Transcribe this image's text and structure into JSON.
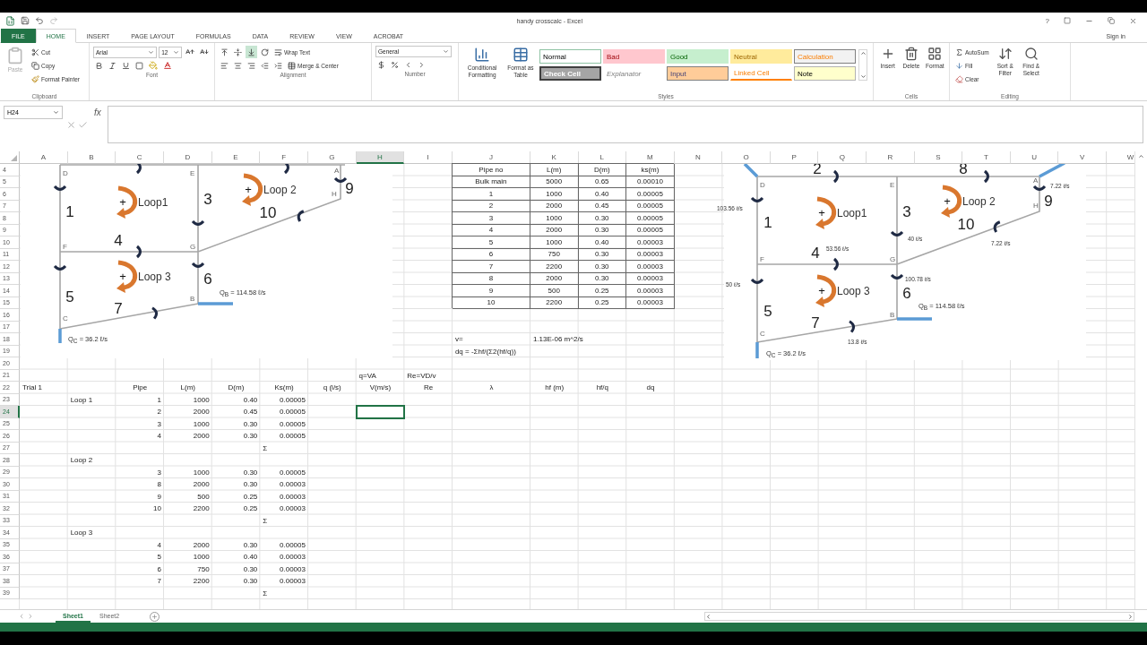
{
  "title_bar": {
    "title": "handy crosscalc - Excel",
    "help": "?"
  },
  "tabs": [
    {
      "label": "FILE",
      "kind": "file",
      "selected": false
    },
    {
      "label": "HOME",
      "kind": "tab",
      "selected": true
    },
    {
      "label": "INSERT",
      "kind": "tab",
      "selected": false
    },
    {
      "label": "PAGE LAYOUT",
      "kind": "tab",
      "selected": false
    },
    {
      "label": "FORMULAS",
      "kind": "tab",
      "selected": false
    },
    {
      "label": "DATA",
      "kind": "tab",
      "selected": false
    },
    {
      "label": "REVIEW",
      "kind": "tab",
      "selected": false
    },
    {
      "label": "VIEW",
      "kind": "tab",
      "selected": false
    },
    {
      "label": "ACROBAT",
      "kind": "tab",
      "selected": false
    }
  ],
  "account": "Sign in",
  "ribbon": {
    "clipboard": {
      "label": "Clipboard",
      "paste": {
        "label": "Paste",
        "disabled": true
      },
      "cut": "Cut",
      "copy": "Copy",
      "format_painter": "Format Painter"
    },
    "font": {
      "label": "Font",
      "name": "Arial",
      "size": "12"
    },
    "alignment": {
      "label": "Alignment",
      "wrap": "Wrap Text",
      "merge": "Merge & Center",
      "vertical_align": [
        {
          "selected": false
        },
        {
          "selected": false
        },
        {
          "selected": true
        }
      ]
    },
    "number": {
      "label": "Number",
      "format": "General"
    },
    "styles": {
      "label": "Styles",
      "conditional": "Conditional Formatting",
      "format_table": "Format as Table",
      "gallery": [
        {
          "text": "Normal",
          "kind": "normal"
        },
        {
          "text": "Bad",
          "kind": "bad"
        },
        {
          "text": "Good",
          "kind": "good"
        },
        {
          "text": "Neutral",
          "kind": "neutral"
        },
        {
          "text": "Calculation",
          "kind": "calculation"
        },
        {
          "text": "Check Cell",
          "kind": "check"
        },
        {
          "text": "Explanator",
          "kind": "explanatory"
        },
        {
          "text": "Input",
          "kind": "input"
        },
        {
          "text": "Linked Cell",
          "kind": "linked"
        },
        {
          "text": "Note",
          "kind": "note"
        }
      ]
    },
    "cells": {
      "label": "Cells",
      "buttons": [
        "Insert",
        "Delete",
        "Format"
      ]
    },
    "editing": {
      "label": "Editing",
      "autosum": "AutoSum",
      "fill": "Fill",
      "clear": "Clear",
      "sort": "Sort & Filter",
      "find": "Find & Select"
    }
  },
  "formula_bar": {
    "name_box": "H24",
    "insert_function": "fx"
  },
  "sheet": {
    "columns": [
      {
        "label": "A",
        "selected": false
      },
      {
        "label": "B",
        "selected": false
      },
      {
        "label": "C",
        "selected": false
      },
      {
        "label": "D",
        "selected": false
      },
      {
        "label": "E",
        "selected": false
      },
      {
        "label": "F",
        "selected": false
      },
      {
        "label": "G",
        "selected": false
      },
      {
        "label": "H",
        "selected": true
      },
      {
        "label": "I",
        "selected": false
      },
      {
        "label": "J",
        "selected": false
      },
      {
        "label": "K",
        "selected": false
      },
      {
        "label": "L",
        "selected": false
      },
      {
        "label": "M",
        "selected": false
      },
      {
        "label": "N",
        "selected": false
      },
      {
        "label": "O",
        "selected": false
      },
      {
        "label": "P",
        "selected": false
      },
      {
        "label": "Q",
        "selected": false
      },
      {
        "label": "R",
        "selected": false
      },
      {
        "label": "S",
        "selected": false
      },
      {
        "label": "T",
        "selected": false
      },
      {
        "label": "U",
        "selected": false
      },
      {
        "label": "V",
        "selected": false
      },
      {
        "label": "W",
        "selected": false
      }
    ],
    "rows": [
      {
        "number": "4",
        "selected": false,
        "cells": {
          "J": {
            "text": "Pipe no",
            "kind": "table",
            "selected": false
          },
          "K": {
            "text": "L(m)",
            "kind": "table",
            "selected": false
          },
          "L": {
            "text": "D(m)",
            "kind": "table",
            "selected": false
          },
          "M": {
            "text": "ks(m)",
            "kind": "table",
            "selected": false
          }
        }
      },
      {
        "number": "5",
        "selected": false,
        "cells": {
          "J": {
            "text": "Bulk main",
            "kind": "table",
            "selected": false
          },
          "K": {
            "text": "5000",
            "kind": "table",
            "selected": false
          },
          "L": {
            "text": "0.65",
            "kind": "table",
            "selected": false
          },
          "M": {
            "text": "0.00010",
            "kind": "table",
            "selected": false
          }
        }
      },
      {
        "number": "6",
        "selected": false,
        "cells": {
          "J": {
            "text": "1",
            "kind": "table",
            "selected": false
          },
          "K": {
            "text": "1000",
            "kind": "table",
            "selected": false
          },
          "L": {
            "text": "0.40",
            "kind": "table",
            "selected": false
          },
          "M": {
            "text": "0.00005",
            "kind": "table",
            "selected": false
          }
        }
      },
      {
        "number": "7",
        "selected": false,
        "cells": {
          "J": {
            "text": "2",
            "kind": "table",
            "selected": false
          },
          "K": {
            "text": "2000",
            "kind": "table",
            "selected": false
          },
          "L": {
            "text": "0.45",
            "kind": "table",
            "selected": false
          },
          "M": {
            "text": "0.00005",
            "kind": "table",
            "selected": false
          }
        }
      },
      {
        "number": "8",
        "selected": false,
        "cells": {
          "J": {
            "text": "3",
            "kind": "table",
            "selected": false
          },
          "K": {
            "text": "1000",
            "kind": "table",
            "selected": false
          },
          "L": {
            "text": "0.30",
            "kind": "table",
            "selected": false
          },
          "M": {
            "text": "0.00005",
            "kind": "table",
            "selected": false
          }
        }
      },
      {
        "number": "9",
        "selected": false,
        "cells": {
          "J": {
            "text": "4",
            "kind": "table",
            "selected": false
          },
          "K": {
            "text": "2000",
            "kind": "table",
            "selected": false
          },
          "L": {
            "text": "0.30",
            "kind": "table",
            "selected": false
          },
          "M": {
            "text": "0.00005",
            "kind": "table",
            "selected": false
          }
        }
      },
      {
        "number": "10",
        "selected": false,
        "cells": {
          "J": {
            "text": "5",
            "kind": "table",
            "selected": false
          },
          "K": {
            "text": "1000",
            "kind": "table",
            "selected": false
          },
          "L": {
            "text": "0.40",
            "kind": "table",
            "selected": false
          },
          "M": {
            "text": "0.00003",
            "kind": "table",
            "selected": false
          }
        }
      },
      {
        "number": "11",
        "selected": false,
        "cells": {
          "J": {
            "text": "6",
            "kind": "table",
            "selected": false
          },
          "K": {
            "text": "750",
            "kind": "table",
            "selected": false
          },
          "L": {
            "text": "0.30",
            "kind": "table",
            "selected": false
          },
          "M": {
            "text": "0.00003",
            "kind": "table",
            "selected": false
          }
        }
      },
      {
        "number": "12",
        "selected": false,
        "cells": {
          "J": {
            "text": "7",
            "kind": "table",
            "selected": false
          },
          "K": {
            "text": "2200",
            "kind": "table",
            "selected": false
          },
          "L": {
            "text": "0.30",
            "kind": "table",
            "selected": false
          },
          "M": {
            "text": "0.00003",
            "kind": "table",
            "selected": false
          }
        }
      },
      {
        "number": "13",
        "selected": false,
        "cells": {
          "J": {
            "text": "8",
            "kind": "table",
            "selected": false
          },
          "K": {
            "text": "2000",
            "kind": "table",
            "selected": false
          },
          "L": {
            "text": "0.30",
            "kind": "table",
            "selected": false
          },
          "M": {
            "text": "0.00003",
            "kind": "table",
            "selected": false
          }
        }
      },
      {
        "number": "14",
        "selected": false,
        "cells": {
          "J": {
            "text": "9",
            "kind": "table",
            "selected": false
          },
          "K": {
            "text": "500",
            "kind": "table",
            "selected": false
          },
          "L": {
            "text": "0.25",
            "kind": "table",
            "selected": false
          },
          "M": {
            "text": "0.00003",
            "kind": "table",
            "selected": false
          }
        }
      },
      {
        "number": "15",
        "selected": false,
        "cells": {
          "J": {
            "text": "10",
            "kind": "table",
            "selected": false
          },
          "K": {
            "text": "2200",
            "kind": "table",
            "selected": false
          },
          "L": {
            "text": "0.25",
            "kind": "table",
            "selected": false
          },
          "M": {
            "text": "0.00003",
            "kind": "table",
            "selected": false
          }
        }
      },
      {
        "number": "16",
        "selected": false
      },
      {
        "number": "17",
        "selected": false
      },
      {
        "number": "18",
        "selected": false,
        "cells": {
          "J": {
            "text": "v=",
            "kind": "text",
            "selected": false
          },
          "K": {
            "text": "1.13E-06 m^2/s",
            "kind": "spill",
            "selected": false
          }
        }
      },
      {
        "number": "19",
        "selected": false,
        "cells": {
          "J": {
            "text": "dq = -Σhf/(Σ2(hf/q))",
            "kind": "spill",
            "selected": false
          }
        }
      },
      {
        "number": "20",
        "selected": false
      },
      {
        "number": "21",
        "selected": false,
        "cells": {
          "H": {
            "text": "q=VA",
            "kind": "text",
            "selected": false
          },
          "I": {
            "text": "Re=VD/v",
            "kind": "text",
            "selected": false
          }
        }
      },
      {
        "number": "22",
        "selected": false,
        "cells": {
          "A": {
            "text": "Trial 1",
            "kind": "text",
            "selected": false
          },
          "C": {
            "text": "Pipe",
            "kind": "heading",
            "selected": false
          },
          "D": {
            "text": "L(m)",
            "kind": "heading",
            "selected": false
          },
          "E": {
            "text": "D(m)",
            "kind": "heading",
            "selected": false
          },
          "F": {
            "text": "Ks(m)",
            "kind": "heading",
            "selected": false
          },
          "G": {
            "text": "q (l/s)",
            "kind": "heading",
            "selected": false
          },
          "H": {
            "text": "V(m/s)",
            "kind": "heading",
            "selected": false
          },
          "I": {
            "text": "Re",
            "kind": "heading",
            "selected": false
          },
          "J": {
            "text": "λ",
            "kind": "heading",
            "selected": false
          },
          "K": {
            "text": "hf (m)",
            "kind": "heading",
            "selected": false
          },
          "L": {
            "text": "hf/q",
            "kind": "heading",
            "selected": false
          },
          "M": {
            "text": "dq",
            "kind": "heading",
            "selected": false
          }
        }
      },
      {
        "number": "23",
        "selected": false,
        "cells": {
          "B": {
            "text": "Loop 1",
            "kind": "text",
            "selected": false
          },
          "C": {
            "text": "1",
            "kind": "number",
            "selected": false
          },
          "D": {
            "text": "1000",
            "kind": "number",
            "selected": false
          },
          "E": {
            "text": "0.40",
            "kind": "number",
            "selected": false
          },
          "F": {
            "text": "0.00005",
            "kind": "number",
            "selected": false
          }
        }
      },
      {
        "number": "24",
        "selected": true,
        "cells": {
          "C": {
            "text": "2",
            "kind": "number",
            "selected": false
          },
          "D": {
            "text": "2000",
            "kind": "number",
            "selected": false
          },
          "E": {
            "text": "0.45",
            "kind": "number",
            "selected": false
          },
          "F": {
            "text": "0.00005",
            "kind": "number",
            "selected": false
          },
          "H": {
            "selected": true
          }
        }
      },
      {
        "number": "25",
        "selected": false,
        "cells": {
          "C": {
            "text": "3",
            "kind": "number",
            "selected": false
          },
          "D": {
            "text": "1000",
            "kind": "number",
            "selected": false
          },
          "E": {
            "text": "0.30",
            "kind": "number",
            "selected": false
          },
          "F": {
            "text": "0.00005",
            "kind": "number",
            "selected": false
          }
        }
      },
      {
        "number": "26",
        "selected": false,
        "cells": {
          "C": {
            "text": "4",
            "kind": "number",
            "selected": false
          },
          "D": {
            "text": "2000",
            "kind": "number",
            "selected": false
          },
          "E": {
            "text": "0.30",
            "kind": "number",
            "selected": false
          },
          "F": {
            "text": "0.00005",
            "kind": "number",
            "selected": false
          }
        }
      },
      {
        "number": "27",
        "selected": false,
        "cells": {
          "F": {
            "text": "Σ",
            "kind": "text",
            "selected": false
          }
        }
      },
      {
        "number": "28",
        "selected": false,
        "cells": {
          "B": {
            "text": "Loop 2",
            "kind": "text",
            "selected": false
          }
        }
      },
      {
        "number": "29",
        "selected": false,
        "cells": {
          "C": {
            "text": "3",
            "kind": "number",
            "selected": false
          },
          "D": {
            "text": "1000",
            "kind": "number",
            "selected": false
          },
          "E": {
            "text": "0.30",
            "kind": "number",
            "selected": false
          },
          "F": {
            "text": "0.00005",
            "kind": "number",
            "selected": false
          }
        }
      },
      {
        "number": "30",
        "selected": false,
        "cells": {
          "C": {
            "text": "8",
            "kind": "number",
            "selected": false
          },
          "D": {
            "text": "2000",
            "kind": "number",
            "selected": false
          },
          "E": {
            "text": "0.30",
            "kind": "number",
            "selected": false
          },
          "F": {
            "text": "0.00003",
            "kind": "number",
            "selected": false
          }
        }
      },
      {
        "number": "31",
        "selected": false,
        "cells": {
          "C": {
            "text": "9",
            "kind": "number",
            "selected": false
          },
          "D": {
            "text": "500",
            "kind": "number",
            "selected": false
          },
          "E": {
            "text": "0.25",
            "kind": "number",
            "selected": false
          },
          "F": {
            "text": "0.00003",
            "kind": "number",
            "selected": false
          }
        }
      },
      {
        "number": "32",
        "selected": false,
        "cells": {
          "C": {
            "text": "10",
            "kind": "number",
            "selected": false
          },
          "D": {
            "text": "2200",
            "kind": "number",
            "selected": false
          },
          "E": {
            "text": "0.25",
            "kind": "number",
            "selected": false
          },
          "F": {
            "text": "0.00003",
            "kind": "number",
            "selected": false
          }
        }
      },
      {
        "number": "33",
        "selected": false,
        "cells": {
          "F": {
            "text": "Σ",
            "kind": "text",
            "selected": false
          }
        }
      },
      {
        "number": "34",
        "selected": false,
        "cells": {
          "B": {
            "text": "Loop 3",
            "kind": "text",
            "selected": false
          }
        }
      },
      {
        "number": "35",
        "selected": false,
        "cells": {
          "C": {
            "text": "4",
            "kind": "number",
            "selected": false
          },
          "D": {
            "text": "2000",
            "kind": "number",
            "selected": false
          },
          "E": {
            "text": "0.30",
            "kind": "number",
            "selected": false
          },
          "F": {
            "text": "0.00005",
            "kind": "number",
            "selected": false
          }
        }
      },
      {
        "number": "36",
        "selected": false,
        "cells": {
          "C": {
            "text": "5",
            "kind": "number",
            "selected": false
          },
          "D": {
            "text": "1000",
            "kind": "number",
            "selected": false
          },
          "E": {
            "text": "0.40",
            "kind": "number",
            "selected": false
          },
          "F": {
            "text": "0.00003",
            "kind": "number",
            "selected": false
          }
        }
      },
      {
        "number": "37",
        "selected": false,
        "cells": {
          "C": {
            "text": "6",
            "kind": "number",
            "selected": false
          },
          "D": {
            "text": "750",
            "kind": "number",
            "selected": false
          },
          "E": {
            "text": "0.30",
            "kind": "number",
            "selected": false
          },
          "F": {
            "text": "0.00003",
            "kind": "number",
            "selected": false
          }
        }
      },
      {
        "number": "38",
        "selected": false,
        "cells": {
          "C": {
            "text": "7",
            "kind": "number",
            "selected": false
          },
          "D": {
            "text": "2200",
            "kind": "number",
            "selected": false
          },
          "E": {
            "text": "0.30",
            "kind": "number",
            "selected": false
          },
          "F": {
            "text": "0.00003",
            "kind": "number",
            "selected": false
          }
        }
      },
      {
        "number": "39",
        "selected": false,
        "cells": {
          "F": {
            "text": "Σ",
            "kind": "text",
            "selected": false
          }
        }
      }
    ]
  },
  "diagrams": [
    {
      "nodes": [
        {
          "label": "D"
        },
        {
          "label": "E"
        },
        {
          "label": "F"
        },
        {
          "label": "G"
        },
        {
          "label": "A"
        },
        {
          "label": "H"
        },
        {
          "label": "B"
        },
        {
          "label": "C"
        }
      ],
      "pipes": [
        {
          "label": "1"
        },
        {
          "label": "3"
        },
        {
          "label": "4"
        },
        {
          "label": "5"
        },
        {
          "label": "6"
        },
        {
          "label": "7"
        },
        {
          "label": "9"
        },
        {
          "label": "10"
        }
      ],
      "loops": [
        {
          "sign": "+",
          "label": "Loop1"
        },
        {
          "sign": "+",
          "label": "Loop 2"
        },
        {
          "sign": "+",
          "label": "Loop 3"
        }
      ],
      "outlets": [
        {
          "symbol": "Q",
          "subscript": "B",
          "text": " = 114.58 ℓ/s"
        },
        {
          "symbol": "Q",
          "subscript": "C",
          "text": " = 36.2 ℓ/s"
        }
      ]
    },
    {
      "nodes": [
        {
          "label": "D"
        },
        {
          "label": "E"
        },
        {
          "label": "F"
        },
        {
          "label": "G"
        },
        {
          "label": "A"
        },
        {
          "label": "H"
        },
        {
          "label": "B"
        },
        {
          "label": "C"
        }
      ],
      "pipes": [
        {
          "label": "2"
        },
        {
          "label": "8"
        },
        {
          "label": "1"
        },
        {
          "label": "3"
        },
        {
          "label": "4"
        },
        {
          "label": "5"
        },
        {
          "label": "6"
        },
        {
          "label": "7"
        },
        {
          "label": "9"
        },
        {
          "label": "10"
        }
      ],
      "loops": [
        {
          "sign": "+",
          "label": "Loop1"
        },
        {
          "sign": "+",
          "label": "Loop 2"
        },
        {
          "sign": "+",
          "label": "Loop 3"
        }
      ],
      "flows": [
        {
          "text": "103.56 ℓ/s"
        },
        {
          "text": "53.56 ℓ/s"
        },
        {
          "text": "40 ℓ/s"
        },
        {
          "text": "50 ℓ/s"
        },
        {
          "text": "100.78 ℓ/s"
        },
        {
          "text": "7.22 ℓ/s"
        },
        {
          "text": "7.22 ℓ/s"
        },
        {
          "text": "13.8 ℓ/s"
        }
      ],
      "outlets": [
        {
          "symbol": "Q",
          "subscript": "B",
          "text": " = 114.58 ℓ/s"
        },
        {
          "symbol": "Q",
          "subscript": "C",
          "text": " = 36.2 ℓ/s"
        }
      ]
    }
  ],
  "sheet_tabs": [
    {
      "label": "Sheet1",
      "selected": true
    },
    {
      "label": "Sheet2",
      "selected": false
    }
  ]
}
